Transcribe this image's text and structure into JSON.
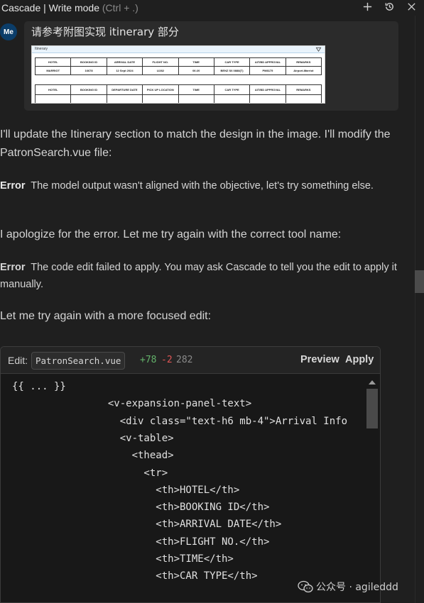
{
  "titlebar": {
    "title": "Cascade | Write mode",
    "shortcut": "(Ctrl + .)",
    "actions": [
      "plus-icon",
      "history-icon",
      "close-icon"
    ]
  },
  "user_message": {
    "avatar": "Me",
    "prompt": "请参考附图实现 itinerary 部分",
    "attachment": {
      "header": "Itinerary",
      "table1": {
        "headers": [
          "HOTEL",
          "BOOKING ID",
          "ARRIVAL DATE",
          "FLIGHT NO.",
          "TIME",
          "CAR TYPE",
          "AIT/BD APPROVAL",
          "REMARKS"
        ],
        "row": [
          "MARRIOT",
          "16678",
          "12 Sept 2024",
          "LI282",
          "06:20",
          "BENZ S6 0888(T)",
          "PM8175",
          "Airport-Marriot"
        ]
      },
      "table2": {
        "headers": [
          "HOTEL",
          "BOOKING ID",
          "DEPARTURE DATE",
          "PICK UP LOCATION",
          "TIME",
          "CAR TYPE",
          "AIT/BD APPROVAL",
          "REMARKS"
        ],
        "row": [
          "",
          "",
          "",
          "",
          "",
          "",
          "",
          ""
        ]
      }
    }
  },
  "assistant": {
    "p1": "I'll update the Itinerary section to match the design in the image. I'll modify the PatronSearch.vue file:",
    "error1_label": "Error",
    "error1_text": "The model output wasn't aligned with the objective, let's try something else.",
    "p2": "I apologize for the error. Let me try again with the correct tool name:",
    "error2_label": "Error",
    "error2_text": "The code edit failed to apply. You may ask Cascade to tell you the edit to apply it manually.",
    "p3": "Let me try again with a more focused edit:"
  },
  "code_edit": {
    "edit_label": "Edit:",
    "file": "PatronSearch.vue",
    "added": "+78",
    "removed": "-2",
    "total": "282",
    "preview_label": "Preview",
    "apply_label": "Apply",
    "lines": [
      "{{ ... }}",
      "                <v-expansion-panel-text>",
      "                  <div class=\"text-h6 mb-4\">Arrival Info",
      "                  <v-table>",
      "                    <thead>",
      "                      <tr>",
      "                        <th>HOTEL</th>",
      "                        <th>BOOKING ID</th>",
      "                        <th>ARRIVAL DATE</th>",
      "                        <th>FLIGHT NO.</th>",
      "                        <th>TIME</th>",
      "                        <th>CAR TYPE</th>"
    ]
  },
  "watermark": "公众号 · agileddd"
}
